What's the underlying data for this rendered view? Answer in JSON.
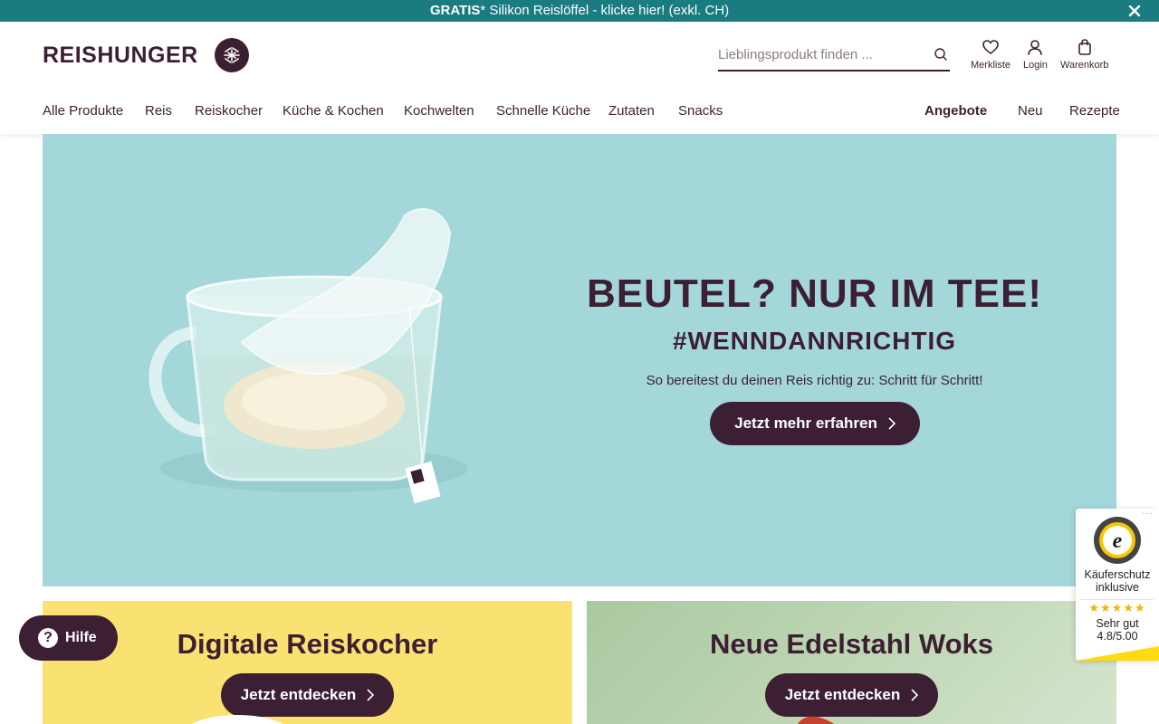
{
  "promo": {
    "bold": "GRATIS",
    "text": "* Silikon Reislöffel - klicke hier! (exkl. CH)",
    "close_icon": "close-icon"
  },
  "header": {
    "logo_text": "REISHUNGER",
    "search": {
      "placeholder": "Lieblingsprodukt finden ...",
      "value": "",
      "icon": "search-icon"
    },
    "actions": [
      {
        "label": "Merkliste",
        "icon": "heart-icon"
      },
      {
        "label": "Login",
        "icon": "user-icon"
      },
      {
        "label": "Warenkorb",
        "icon": "bag-icon"
      }
    ]
  },
  "nav": {
    "left": [
      "Alle Produkte",
      "Reis",
      "Reiskocher",
      "Küche & Kochen",
      "Kochwelten",
      "Schnelle Küche",
      "Zutaten",
      "Snacks"
    ],
    "right": [
      "Angebote",
      "Neu",
      "Rezepte"
    ]
  },
  "hero": {
    "title": "BEUTEL? NUR IM TEE!",
    "tag": "#WENNDANNRICHTIG",
    "text": "So bereitest du deinen Reis richtig zu: Schritt für Schritt!",
    "button": "Jetzt mehr erfahren",
    "background": "#a3d7d9"
  },
  "cards": [
    {
      "title": "Digitale Reiskocher",
      "button": "Jetzt entdecken",
      "background": "#f9e172"
    },
    {
      "title": "Neue Edelstahl Woks",
      "button": "Jetzt entdecken",
      "background": "#b9d3af"
    }
  ],
  "help": {
    "label": "Hilfe"
  },
  "trusted_shops": {
    "line1": "Käuferschutz",
    "line2": "inklusive",
    "stars": "★★★★★",
    "rating_text": "Sehr gut",
    "score": "4.8/5.00"
  },
  "colors": {
    "brand": "#3c1f33",
    "promo_bar": "#1a7b80",
    "star": "#f5b400"
  }
}
